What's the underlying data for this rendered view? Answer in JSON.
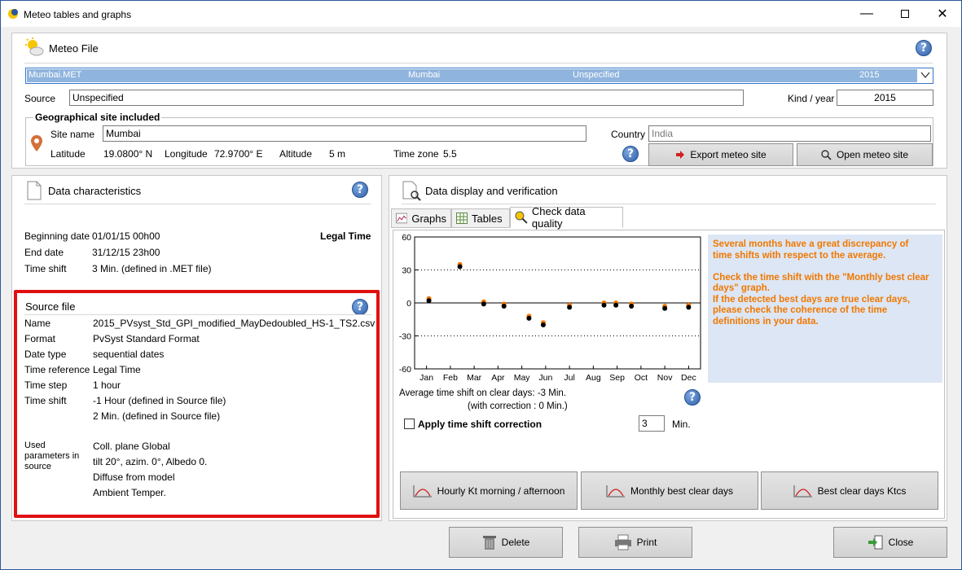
{
  "window": {
    "title": "Meteo tables and graphs"
  },
  "meteo_file": {
    "header": "Meteo File",
    "selected": {
      "file": "Mumbai.MET",
      "site": "Mumbai",
      "source": "Unspecified",
      "year": "2015"
    },
    "source_label": "Source",
    "source_value": "Unspecified",
    "kind_year_label": "Kind / year",
    "kind_year_value": "2015"
  },
  "geo": {
    "header": "Geographical site included",
    "site_name_label": "Site name",
    "site_name_value": "Mumbai",
    "country_label": "Country",
    "country_value": "India",
    "latitude_label": "Latitude",
    "latitude_value": "19.0800° N",
    "longitude_label": "Longitude",
    "longitude_value": "72.9700° E",
    "altitude_label": "Altitude",
    "altitude_value": "5 m",
    "timezone_label": "Time zone",
    "timezone_value": "5.5",
    "export_button": "Export meteo site",
    "open_button": "Open meteo site"
  },
  "data_char": {
    "header": "Data characteristics",
    "beginning_label": "Beginning date",
    "beginning_value": "01/01/15 00h00",
    "legal_time": "Legal Time",
    "end_label": "End date",
    "end_value": "31/12/15 23h00",
    "shift_label": "Time shift",
    "shift_value": "3 Min. (defined in .MET file)"
  },
  "source_file": {
    "header": "Source file",
    "rows": [
      {
        "label": "Name",
        "value": "2015_PVsyst_Std_GPI_modified_MayDedoubled_HS-1_TS2.csv"
      },
      {
        "label": "Format",
        "value": "PvSyst Standard Format"
      },
      {
        "label": "Date type",
        "value": "sequential dates"
      },
      {
        "label": "Time reference",
        "value": "Legal Time"
      },
      {
        "label": "Time step",
        "value": "1 hour"
      },
      {
        "label": "Time shift",
        "value": "-1 Hour (defined in Source file)"
      }
    ],
    "shift_extra": "2 Min. (defined in Source file)",
    "used_label": "Used parameters in source",
    "used_values": [
      "Coll. plane Global",
      "tilt 20°, azim. 0°, Albedo 0.20",
      "Diffuse from model",
      "Ambient Temper."
    ]
  },
  "display": {
    "header": "Data display and verification",
    "tabs": [
      "Graphs",
      "Tables",
      "Check data quality"
    ],
    "message_lines": [
      "Several months have a great discrepancy of",
      "time shifts with respect to the average.",
      "",
      "Check the time shift with the \"Monthly best clear",
      "days\" graph.",
      "If the detected best days are true clear days,",
      "please check the coherence of the time",
      "definitions in your data."
    ],
    "avg_text": "Average time shift on clear days: -3 Min.",
    "corr_text": "(with correction : 0 Min.)",
    "apply_label": "Apply time shift correction",
    "min_value": "3",
    "min_label": "Min.",
    "graph_buttons": [
      "Hourly Kt morning / afternoon",
      "Monthly best clear days",
      "Best clear days Ktcs"
    ]
  },
  "chart_data": {
    "type": "scatter",
    "categories": [
      "Jan",
      "Feb",
      "Mar",
      "Apr",
      "May",
      "Jun",
      "Jul",
      "Aug",
      "Sep",
      "Oct",
      "Nov",
      "Dec"
    ],
    "ylim": [
      -60,
      60
    ],
    "yticks": [
      "60",
      "30",
      "0",
      "-30",
      "-60"
    ],
    "grid": "dotted at ±30",
    "series": [
      {
        "color": "#f07800",
        "points": [
          [
            0.1,
            4
          ],
          [
            1.4,
            35
          ],
          [
            2.4,
            1
          ],
          [
            3.25,
            -1
          ],
          [
            4.3,
            -12
          ],
          [
            4.9,
            -18
          ],
          [
            6.0,
            -2
          ],
          [
            7.45,
            0
          ],
          [
            7.95,
            0
          ],
          [
            8.6,
            -1
          ],
          [
            10.0,
            -3
          ],
          [
            11.0,
            -2
          ]
        ]
      },
      {
        "color": "#000000",
        "points": [
          [
            0.1,
            2
          ],
          [
            1.4,
            33
          ],
          [
            2.4,
            -1
          ],
          [
            3.25,
            -3
          ],
          [
            4.3,
            -14
          ],
          [
            4.9,
            -20
          ],
          [
            6.0,
            -4
          ],
          [
            7.45,
            -2
          ],
          [
            7.95,
            -2
          ],
          [
            8.6,
            -3
          ],
          [
            10.0,
            -5
          ],
          [
            11.0,
            -4
          ]
        ]
      }
    ]
  },
  "bottom": {
    "delete": "Delete",
    "print": "Print",
    "close": "Close"
  }
}
